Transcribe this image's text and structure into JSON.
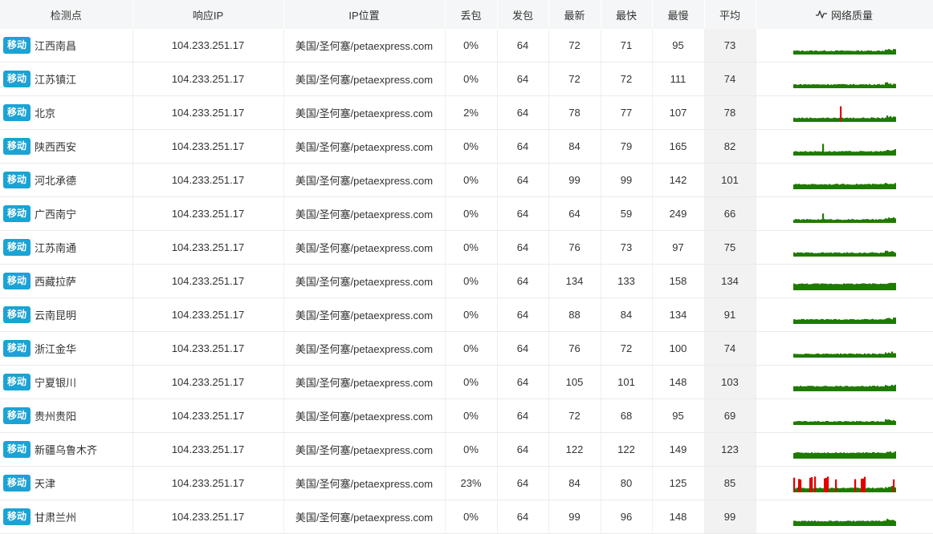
{
  "header": {
    "node": "检测点",
    "ip": "响应IP",
    "location": "IP位置",
    "loss": "丢包",
    "sent": "发包",
    "latest": "最新",
    "fastest": "最快",
    "slowest": "最慢",
    "average": "平均",
    "quality": "网络质量"
  },
  "quality_icon": "pulse-icon",
  "colors": {
    "carrier_badge": "#1aa3d4",
    "spark_ok": "#1e7a00",
    "spark_loss": "#e00000"
  },
  "rows": [
    {
      "carrier": "移动",
      "node": "江西南昌",
      "ip": "104.233.251.17",
      "location": "美国/圣何塞/petaexpress.com",
      "loss": "0%",
      "sent": "64",
      "latest": "72",
      "fastest": "71",
      "slowest": "95",
      "average": "73",
      "loss_pct": 0
    },
    {
      "carrier": "移动",
      "node": "江苏镇江",
      "ip": "104.233.251.17",
      "location": "美国/圣何塞/petaexpress.com",
      "loss": "0%",
      "sent": "64",
      "latest": "72",
      "fastest": "72",
      "slowest": "111",
      "average": "74",
      "loss_pct": 0
    },
    {
      "carrier": "移动",
      "node": "北京",
      "ip": "104.233.251.17",
      "location": "美国/圣何塞/petaexpress.com",
      "loss": "2%",
      "sent": "64",
      "latest": "78",
      "fastest": "77",
      "slowest": "107",
      "average": "78",
      "loss_pct": 2
    },
    {
      "carrier": "移动",
      "node": "陕西西安",
      "ip": "104.233.251.17",
      "location": "美国/圣何塞/petaexpress.com",
      "loss": "0%",
      "sent": "64",
      "latest": "84",
      "fastest": "79",
      "slowest": "165",
      "average": "82",
      "loss_pct": 0
    },
    {
      "carrier": "移动",
      "node": "河北承德",
      "ip": "104.233.251.17",
      "location": "美国/圣何塞/petaexpress.com",
      "loss": "0%",
      "sent": "64",
      "latest": "99",
      "fastest": "99",
      "slowest": "142",
      "average": "101",
      "loss_pct": 0
    },
    {
      "carrier": "移动",
      "node": "广西南宁",
      "ip": "104.233.251.17",
      "location": "美国/圣何塞/petaexpress.com",
      "loss": "0%",
      "sent": "64",
      "latest": "64",
      "fastest": "59",
      "slowest": "249",
      "average": "66",
      "loss_pct": 0
    },
    {
      "carrier": "移动",
      "node": "江苏南通",
      "ip": "104.233.251.17",
      "location": "美国/圣何塞/petaexpress.com",
      "loss": "0%",
      "sent": "64",
      "latest": "76",
      "fastest": "73",
      "slowest": "97",
      "average": "75",
      "loss_pct": 0
    },
    {
      "carrier": "移动",
      "node": "西藏拉萨",
      "ip": "104.233.251.17",
      "location": "美国/圣何塞/petaexpress.com",
      "loss": "0%",
      "sent": "64",
      "latest": "134",
      "fastest": "133",
      "slowest": "158",
      "average": "134",
      "loss_pct": 0
    },
    {
      "carrier": "移动",
      "node": "云南昆明",
      "ip": "104.233.251.17",
      "location": "美国/圣何塞/petaexpress.com",
      "loss": "0%",
      "sent": "64",
      "latest": "88",
      "fastest": "84",
      "slowest": "134",
      "average": "91",
      "loss_pct": 0
    },
    {
      "carrier": "移动",
      "node": "浙江金华",
      "ip": "104.233.251.17",
      "location": "美国/圣何塞/petaexpress.com",
      "loss": "0%",
      "sent": "64",
      "latest": "76",
      "fastest": "72",
      "slowest": "100",
      "average": "74",
      "loss_pct": 0
    },
    {
      "carrier": "移动",
      "node": "宁夏银川",
      "ip": "104.233.251.17",
      "location": "美国/圣何塞/petaexpress.com",
      "loss": "0%",
      "sent": "64",
      "latest": "105",
      "fastest": "101",
      "slowest": "148",
      "average": "103",
      "loss_pct": 0
    },
    {
      "carrier": "移动",
      "node": "贵州贵阳",
      "ip": "104.233.251.17",
      "location": "美国/圣何塞/petaexpress.com",
      "loss": "0%",
      "sent": "64",
      "latest": "72",
      "fastest": "68",
      "slowest": "95",
      "average": "69",
      "loss_pct": 0
    },
    {
      "carrier": "移动",
      "node": "新疆乌鲁木齐",
      "ip": "104.233.251.17",
      "location": "美国/圣何塞/petaexpress.com",
      "loss": "0%",
      "sent": "64",
      "latest": "122",
      "fastest": "122",
      "slowest": "149",
      "average": "123",
      "loss_pct": 0
    },
    {
      "carrier": "移动",
      "node": "天津",
      "ip": "104.233.251.17",
      "location": "美国/圣何塞/petaexpress.com",
      "loss": "23%",
      "sent": "64",
      "latest": "84",
      "fastest": "80",
      "slowest": "125",
      "average": "85",
      "loss_pct": 23
    },
    {
      "carrier": "移动",
      "node": "甘肃兰州",
      "ip": "104.233.251.17",
      "location": "美国/圣何塞/petaexpress.com",
      "loss": "0%",
      "sent": "64",
      "latest": "99",
      "fastest": "96",
      "slowest": "148",
      "average": "99",
      "loss_pct": 0
    }
  ]
}
